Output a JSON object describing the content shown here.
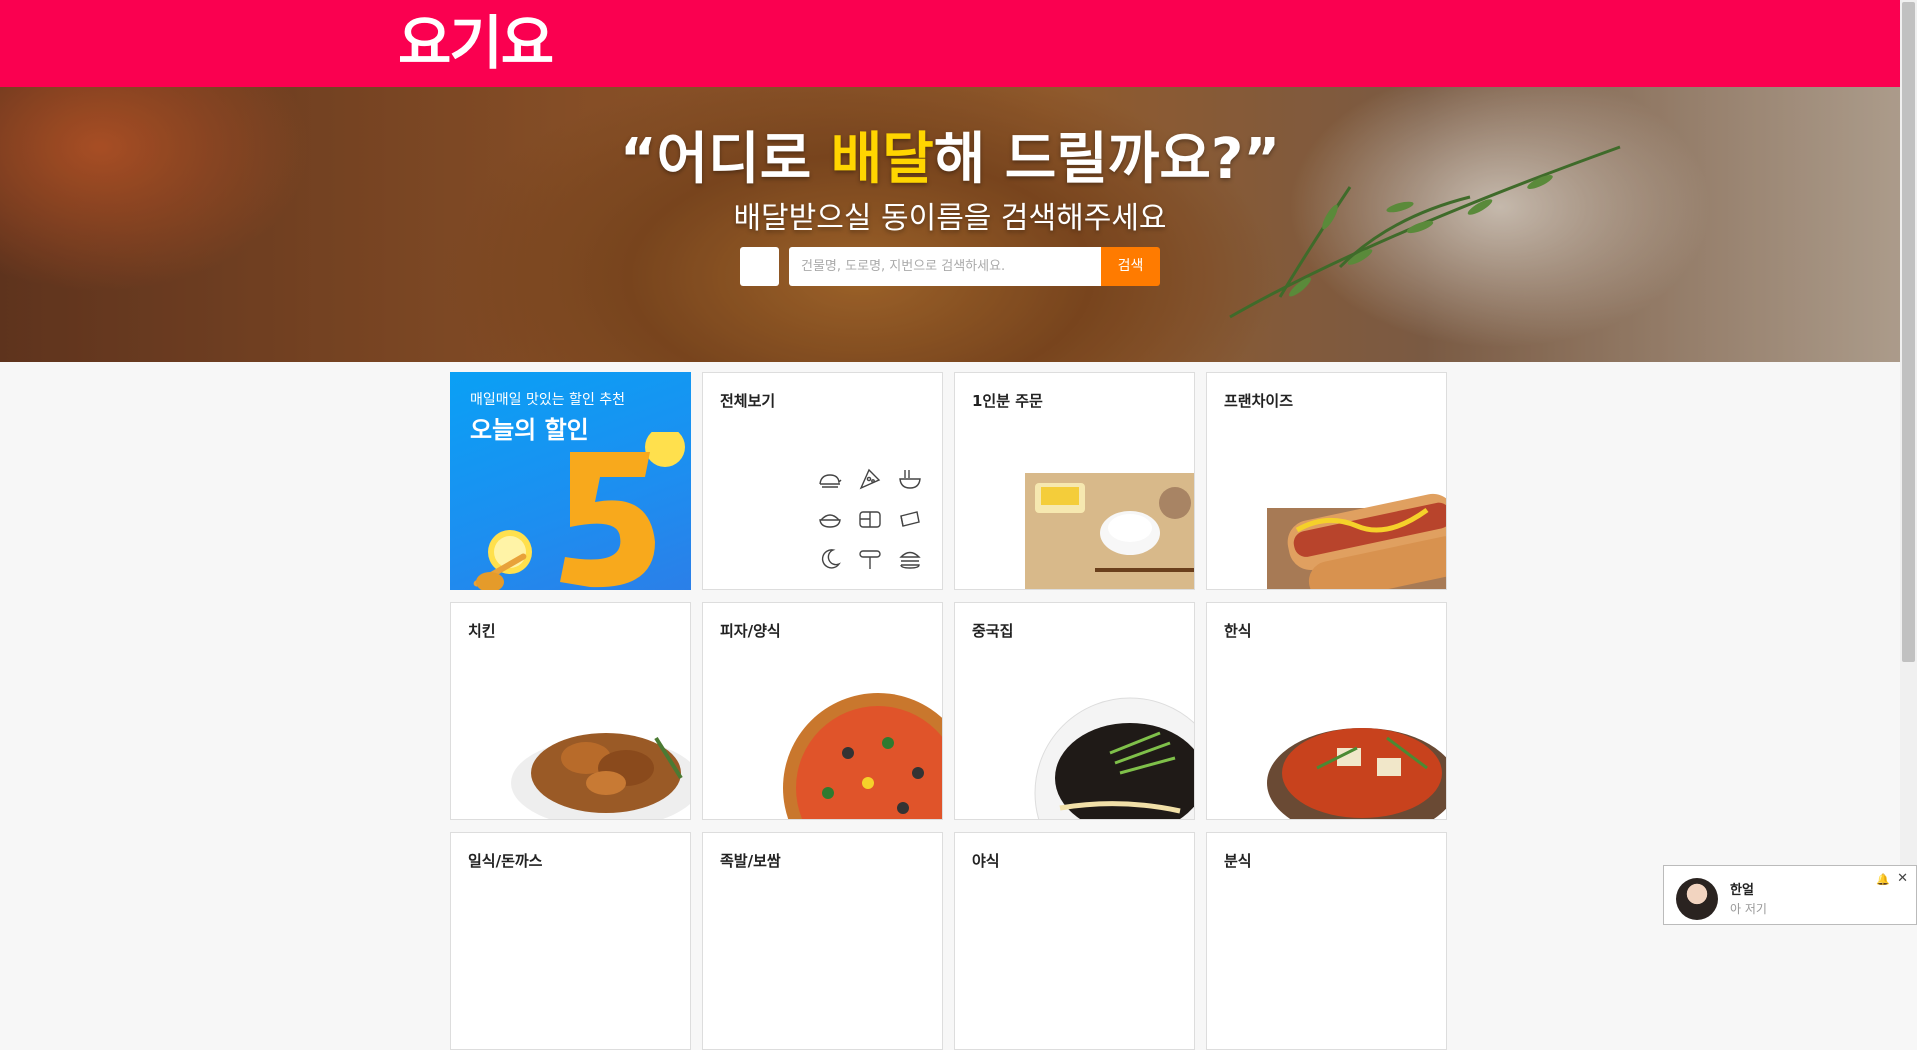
{
  "header": {
    "logo": "요기요"
  },
  "hero": {
    "title_pre": "“어디로 ",
    "title_highlight": "배달",
    "title_post": "해 드릴까요?”",
    "subtitle": "배달받으실 동이름을 검색해주세요",
    "search_placeholder": "건물명, 도로명, 지번으로 검색하세요.",
    "search_button": "검색"
  },
  "promo": {
    "line1": "매일매일 맛있는 할인 추천",
    "line2": "오늘의 할인"
  },
  "categories": [
    {
      "label": "전체보기"
    },
    {
      "label": "1인분 주문"
    },
    {
      "label": "프랜차이즈"
    },
    {
      "label": "치킨"
    },
    {
      "label": "피자/양식"
    },
    {
      "label": "중국집"
    },
    {
      "label": "한식"
    },
    {
      "label": "일식/돈까스"
    },
    {
      "label": "족발/보쌈"
    },
    {
      "label": "야식"
    },
    {
      "label": "분식"
    }
  ],
  "chat": {
    "name": "한얼",
    "message": "아 저기"
  },
  "colors": {
    "brand": "#fa0050",
    "accent": "#ff7b00",
    "highlight": "#ffd500"
  }
}
